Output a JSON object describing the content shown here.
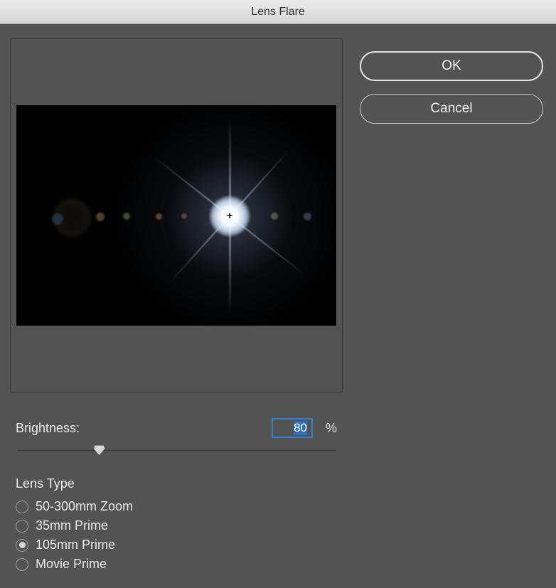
{
  "title": "Lens Flare",
  "buttons": {
    "ok": "OK",
    "cancel": "Cancel"
  },
  "brightness": {
    "label": "Brightness:",
    "value": "80",
    "unit": "%",
    "slider_percent": 26
  },
  "lens_type": {
    "title": "Lens Type",
    "selected_index": 2,
    "options": [
      "50-300mm Zoom",
      "35mm Prime",
      "105mm Prime",
      "Movie Prime"
    ]
  }
}
